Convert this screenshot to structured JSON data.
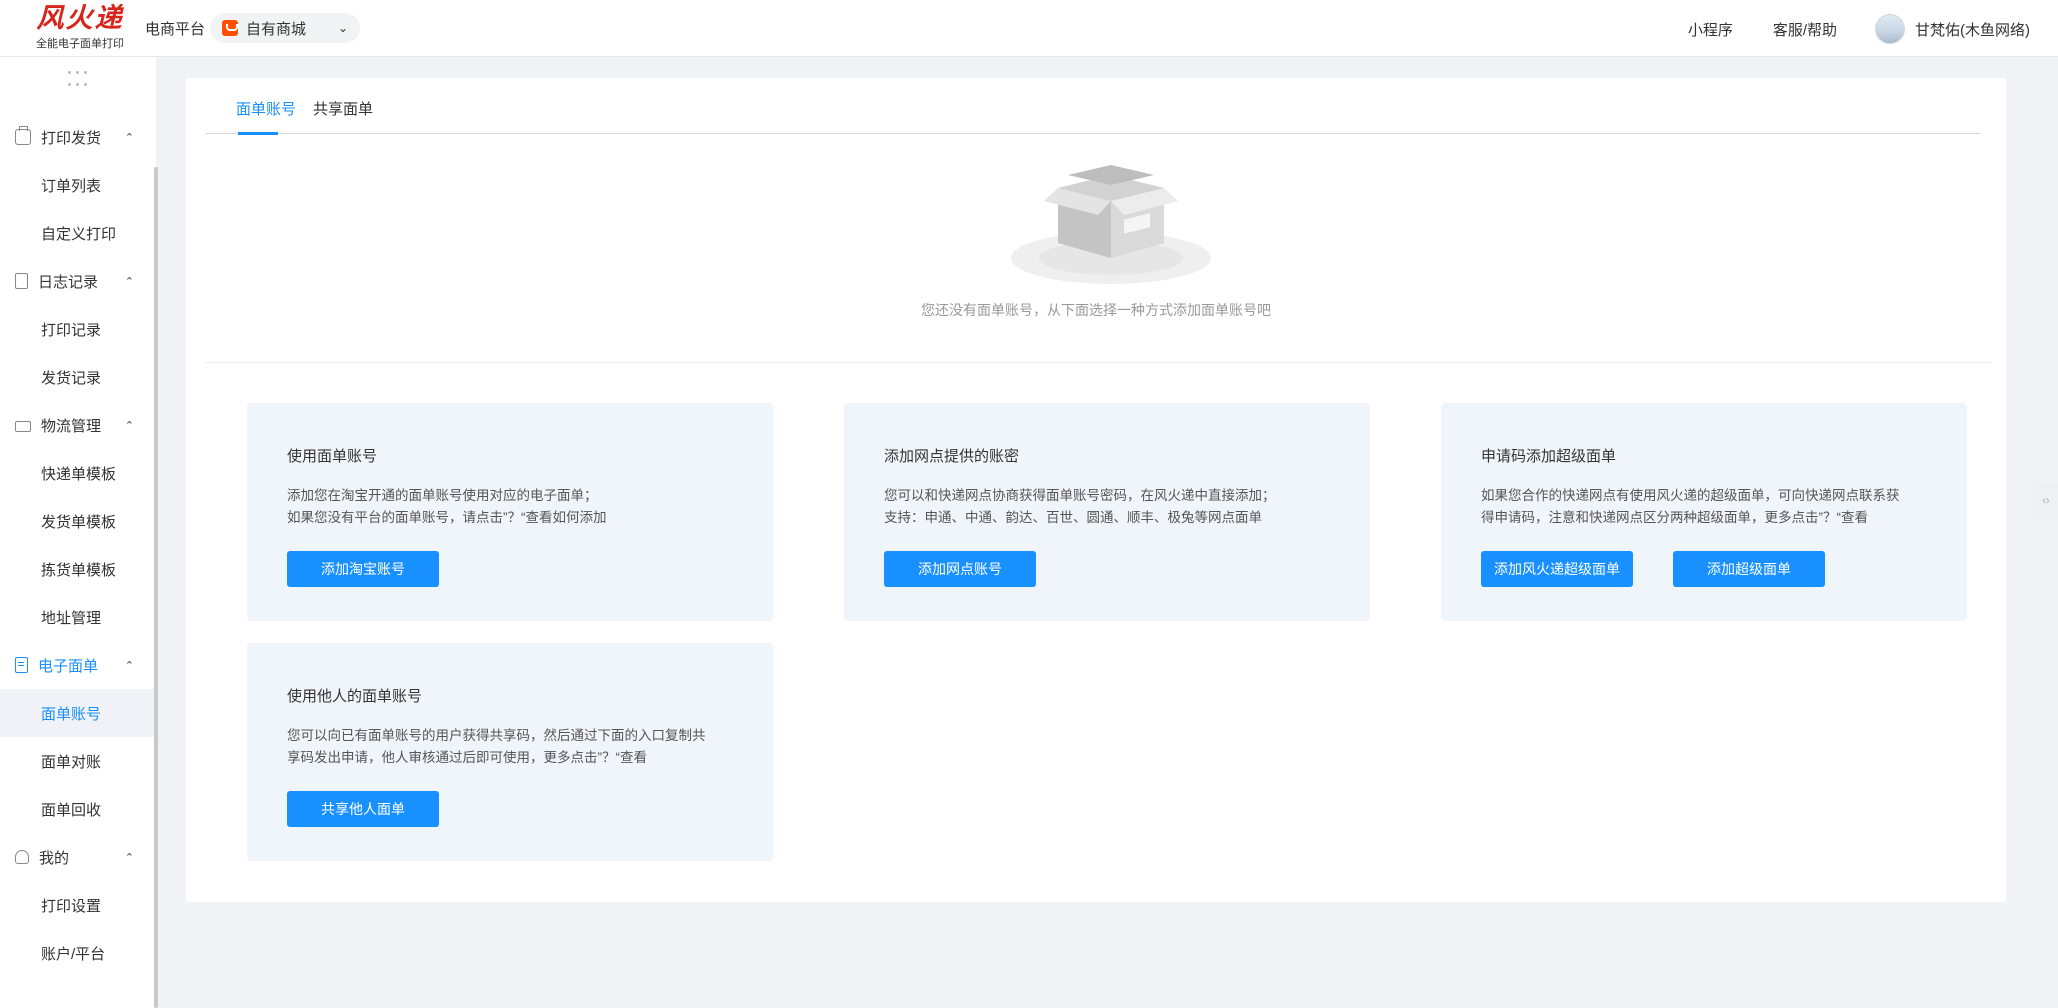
{
  "header": {
    "logo_title": "风火递",
    "logo_subtitle": "全能电子面单打印",
    "platform_label": "电商平台",
    "platform_value": "自有商城",
    "links": [
      "小程序",
      "客服/帮助"
    ],
    "username": "甘梵佑(木鱼网络)"
  },
  "sidebar": {
    "groups": [
      {
        "label": "打印发货",
        "items": [
          "订单列表",
          "自定义打印"
        ]
      },
      {
        "label": "日志记录",
        "items": [
          "打印记录",
          "发货记录"
        ]
      },
      {
        "label": "物流管理",
        "items": [
          "快递单模板",
          "发货单模板",
          "拣货单模板",
          "地址管理"
        ]
      },
      {
        "label": "电子面单",
        "items": [
          "面单账号",
          "面单对账",
          "面单回收"
        ]
      },
      {
        "label": "我的",
        "items": [
          "打印设置",
          "账户/平台"
        ]
      }
    ],
    "active_item": "面单账号"
  },
  "main": {
    "tabs": [
      "面单账号",
      "共享面单"
    ],
    "empty_text": "您还没有面单账号，从下面选择一种方式添加面单账号吧",
    "options": [
      {
        "title": "使用面单账号",
        "desc_line1": "添加您在淘宝开通的面单账号使用对应的电子面单；",
        "desc_line2": "如果您没有平台的面单账号，请点击”？“查看如何添加",
        "buttons": [
          "添加淘宝账号"
        ]
      },
      {
        "title": "添加网点提供的账密",
        "desc_line1": "您可以和快递网点协商获得面单账号密码，在风火递中直接添加；",
        "desc_line2": "支持：申通、中通、韵达、百世、圆通、顺丰、极兔等网点面单",
        "buttons": [
          "添加网点账号"
        ]
      },
      {
        "title": "申请码添加超级面单",
        "desc_line1": "如果您合作的快递网点有使用风火递的超级面单，可向快递网点联系获",
        "desc_line2": "得申请码，注意和快递网点区分两种超级面单，更多点击”？“查看",
        "buttons": [
          "添加风火递超级面单",
          "添加超级面单"
        ]
      },
      {
        "title": "使用他人的面单账号",
        "desc_line1": "您可以向已有面单账号的用户获得共享码，然后通过下面的入口复制共",
        "desc_line2": "享码发出申请，他人审核通过后即可使用，更多点击”？“查看",
        "buttons": [
          "共享他人面单"
        ]
      }
    ]
  },
  "colors": {
    "accent": "#1890ff",
    "brand_red": "#d9241b",
    "card_bg": "#f0f4fb"
  },
  "icons": [
    "printer-icon",
    "document-icon",
    "truck-icon",
    "bill-icon",
    "user-icon",
    "empty-box-icon",
    "chevron-down-icon",
    "chevron-up-icon"
  ]
}
